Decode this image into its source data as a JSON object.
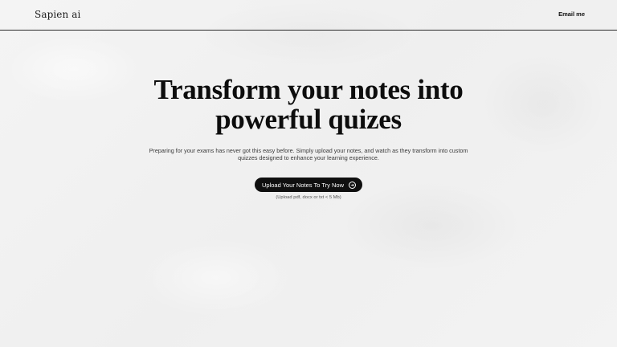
{
  "header": {
    "brand": "Sapien ai",
    "email_link": "Email me"
  },
  "hero": {
    "headline_line1": "Transform your notes into",
    "headline_line2": "powerful quizes",
    "subtext_line1": "Preparing for your exams has never got this easy before. Simply upload your notes, and watch as they transform into custom",
    "subtext_line2": "quizzes designed to enhance your learning experience.",
    "cta_label": "Upload Your Notes To Try Now",
    "cta_icon": "arrow-right-circle-icon",
    "upload_hint": "(Upload pdf, docx or txt < 5 Mb)"
  },
  "colors": {
    "background": "#f2f2f2",
    "text": "#111111",
    "button_bg": "#0f0f0f",
    "button_text": "#ffffff"
  }
}
